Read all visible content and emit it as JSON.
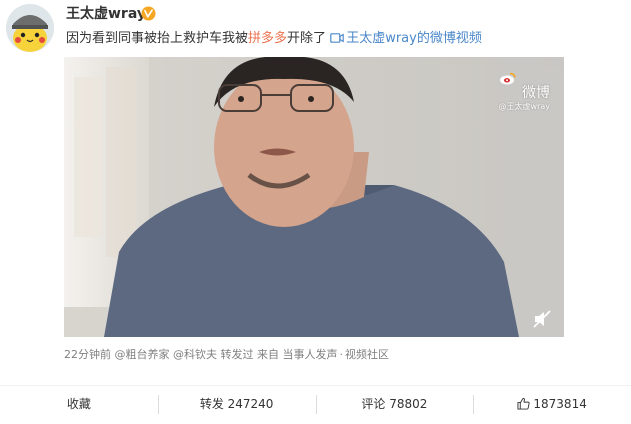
{
  "post": {
    "username": "王太虚wray",
    "text_before": "因为看到同事被抬上救护车我被",
    "mention": "拼多多",
    "text_after": "开除了",
    "video_link_label": "王太虚wray的微博视频"
  },
  "video": {
    "watermark_main": "微博",
    "watermark_sub": "@王太虚wray"
  },
  "meta": {
    "time": "22分钟前",
    "reposted_by_1": "@粗台养家",
    "reposted_by_2": "@科钦夫",
    "repost_label": "转发过",
    "source_prefix": "来自",
    "source_name": "当事人发声",
    "separator": "·",
    "community": "视频社区"
  },
  "actions": {
    "favorite": "收藏",
    "repost": "转发 247240",
    "comment": "评论 78802",
    "like_count": "1873814"
  },
  "colors": {
    "mention": "#eb7350",
    "link": "#4a87c9",
    "verified_badge": "#f5a623"
  }
}
